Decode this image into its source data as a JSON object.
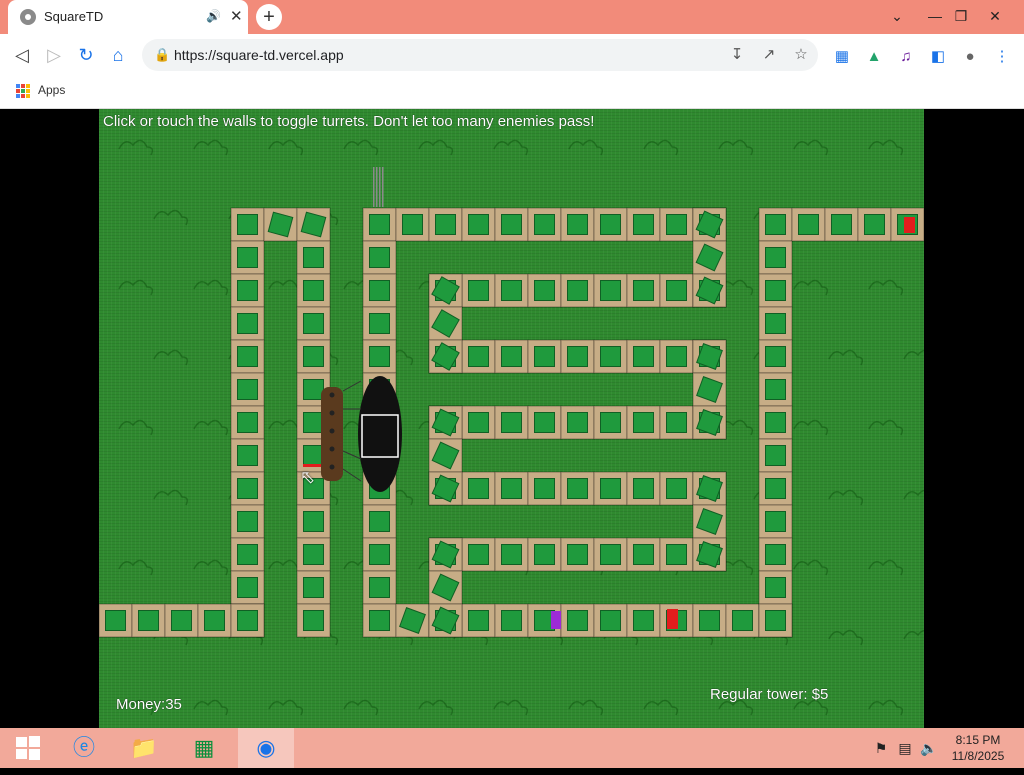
{
  "browser": {
    "tab_title": "SquareTD",
    "url": "https://square-td.vercel.app",
    "bookmarks_apps_label": "Apps"
  },
  "game": {
    "instructions": "Click or touch the walls to toggle turrets. Don't let too many enemies pass!",
    "money_label": "Money:35",
    "tower_price_label": "Regular tower: $5",
    "colors": {
      "grass": "#2f8a2f",
      "wall": "#c7ad86",
      "turret": "#1f9a3d",
      "turret_border": "#106024",
      "enemy_red": "#e21d1d",
      "enemy_purple": "#9d2bd6",
      "ship_hull": "#111111",
      "ship_deck": "#5a3a1e"
    }
  },
  "taskbar": {
    "time": "8:15 PM",
    "date": "11/8/2025"
  }
}
